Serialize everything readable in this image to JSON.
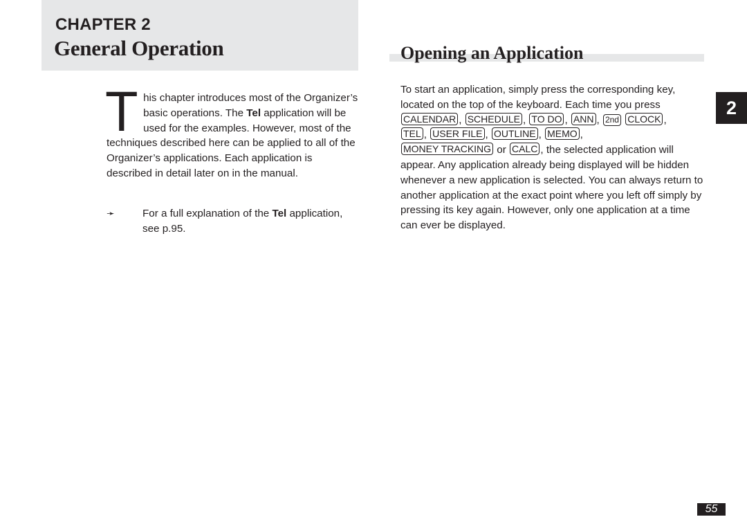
{
  "header": {
    "chapter_label": "CHAPTER 2",
    "chapter_title": "General Operation"
  },
  "intro": {
    "dropcap": "T",
    "text_before_bold": "his chapter introduces most of the Organizer’s basic operations. The ",
    "bold": "Tel",
    "text_after_bold": " application will be used for the examples. However, most of the techniques described here can be applied to all of the Organizer’s applications. Each application is described in detail later on in the manual."
  },
  "note": {
    "arrow_icon": "➛",
    "text_before_bold": "For a full explanation of the ",
    "bold": "Tel",
    "text_after_bold": " application, see p.95."
  },
  "section": {
    "title": "Opening an Application",
    "text_intro": "To start an application, simply press the corresponding key, located on the top of the keyboard. Each time you press ",
    "keys": [
      "CALENDAR",
      "SCHEDULE",
      "TO DO",
      "ANN",
      "2nd",
      "CLOCK",
      "TEL",
      "USER FILE",
      "OUTLINE",
      "MEMO",
      "MONEY TRACKING",
      "CALC"
    ],
    "sep_comma": ", ",
    "sep_space": " ",
    "sep_or": " or ",
    "text_after_keys": ", the selected application will appear. Any application already being displayed will be hidden whenever a new application is selected. You can always return to another application at the exact point where you left off simply by pressing its key again. However, only one application at a time can ever be displayed."
  },
  "side_tab": {
    "label": "2"
  },
  "footer": {
    "page_number": "55"
  }
}
